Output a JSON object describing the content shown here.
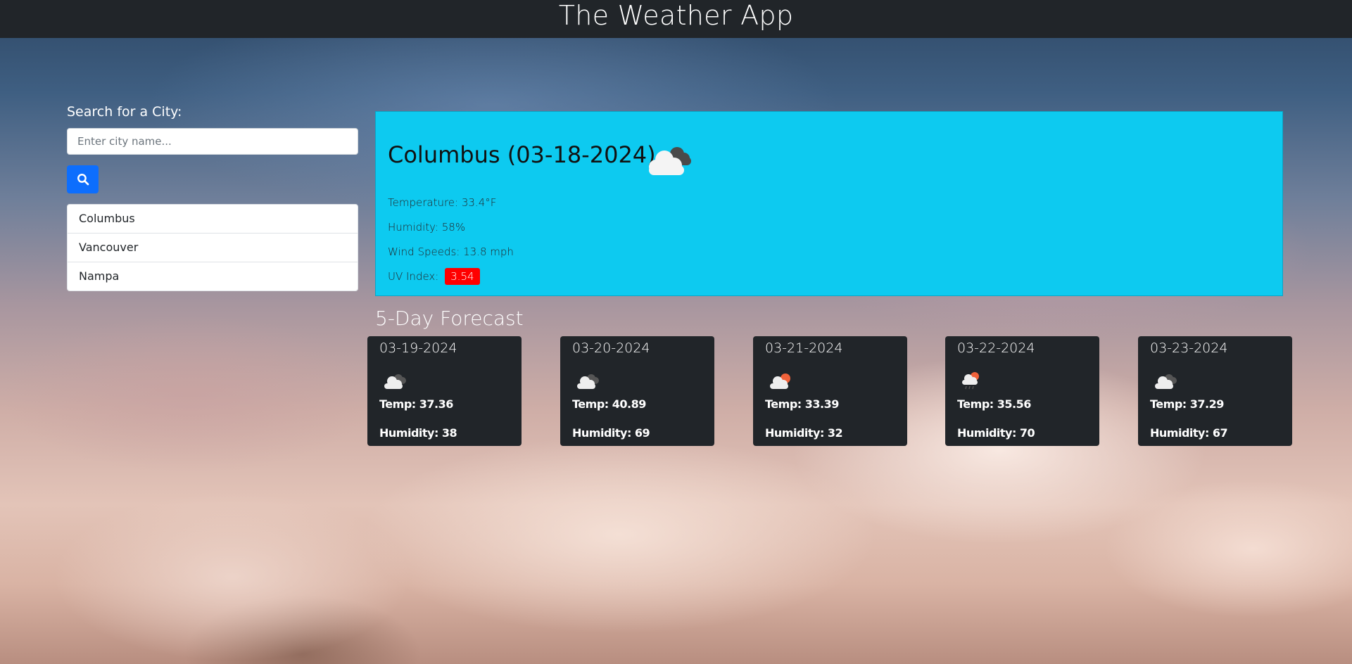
{
  "header": {
    "title": "The Weather App"
  },
  "search": {
    "label": "Search for a City:",
    "placeholder": "Enter city name...",
    "value": "",
    "button_icon": "search-icon"
  },
  "history": [
    "Columbus",
    "Vancouver",
    "Nampa"
  ],
  "current": {
    "title": "Columbus (03-18-2024)",
    "icon": "broken-clouds-icon",
    "temperature": "Temperature: 33.4°F",
    "humidity": "Humidity: 58%",
    "wind": "Wind Speeds: 13.8 mph",
    "uv_label": "UV Index:",
    "uv_value": "3.54",
    "uv_color": "#ff0000"
  },
  "forecast": {
    "title": "5-Day Forecast",
    "days": [
      {
        "date": "03-19-2024",
        "icon": "broken-clouds-icon",
        "temp": "Temp: 37.36",
        "humidity": "Humidity: 38"
      },
      {
        "date": "03-20-2024",
        "icon": "broken-clouds-icon",
        "temp": "Temp: 40.89",
        "humidity": "Humidity: 69"
      },
      {
        "date": "03-21-2024",
        "icon": "few-clouds-day-icon",
        "temp": "Temp: 33.39",
        "humidity": "Humidity: 32"
      },
      {
        "date": "03-22-2024",
        "icon": "rain-day-icon",
        "temp": "Temp: 35.56",
        "humidity": "Humidity: 70"
      },
      {
        "date": "03-23-2024",
        "icon": "broken-clouds-icon",
        "temp": "Temp: 37.29",
        "humidity": "Humidity: 67"
      }
    ]
  },
  "colors": {
    "header_bg": "#212529",
    "current_bg": "#0dcaf0",
    "card_bg": "#212529",
    "search_button": "#0d6efd"
  }
}
